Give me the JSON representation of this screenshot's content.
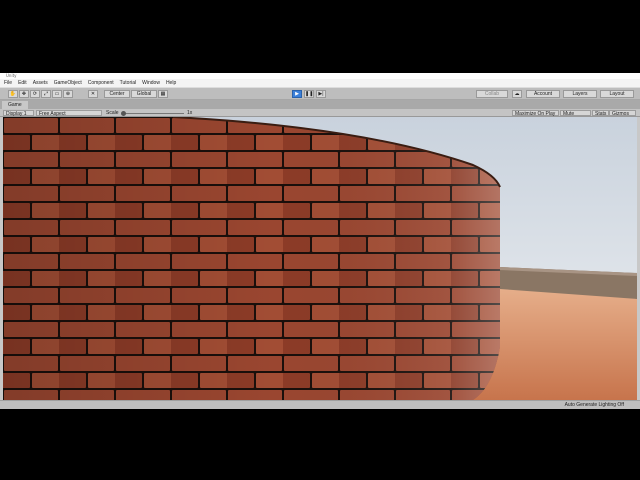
{
  "window": {
    "title": "Unity"
  },
  "menu": [
    "File",
    "Edit",
    "Assets",
    "GameObject",
    "Component",
    "Tutorial",
    "Window",
    "Help"
  ],
  "toolbar": {
    "pivot_label": "Center",
    "space_label": "Global",
    "collab_label": "Collab",
    "account_label": "Account",
    "layers_label": "Layers",
    "layout_label": "Layout"
  },
  "game_tab": {
    "label": "Game"
  },
  "game_bar": {
    "display": "Display 1",
    "aspect": "Free Aspect",
    "scale_label": "Scale",
    "scale_value": "1x",
    "maximize": "Maximize On Play",
    "mute": "Mute Audio",
    "stats": "Stats",
    "gizmos": "Gizmos"
  },
  "status": {
    "text": "Auto Generate Lighting Off"
  },
  "icons": [
    "hand-tool-icon",
    "move-tool-icon",
    "rotate-tool-icon",
    "scale-tool-icon",
    "rect-tool-icon",
    "transform-tool-icon",
    "custom-tool-icon",
    "play-icon",
    "pause-icon",
    "step-icon",
    "cloud-icon"
  ],
  "colors": {
    "play_active": "#3b7fd9",
    "brick": "#8a3a24",
    "floor": "#d98e62",
    "sky": "#dfe5ec"
  }
}
